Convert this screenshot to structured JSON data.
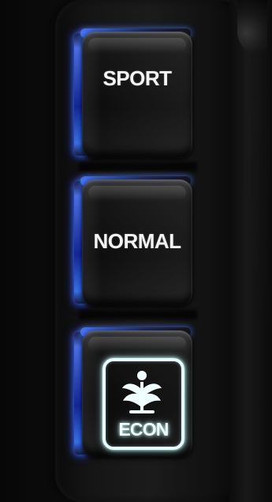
{
  "buttons": [
    {
      "label": "SPORT"
    },
    {
      "label": "NORMAL"
    },
    {
      "label": "ECON"
    }
  ],
  "icons": {
    "econ": "leaf-sprout-icon"
  },
  "colors": {
    "background": "#050505",
    "button_face": "#121212",
    "blue_glow": "#3f6fff",
    "text": "#f4f4f4",
    "econ_glow": "#e8ffff"
  }
}
